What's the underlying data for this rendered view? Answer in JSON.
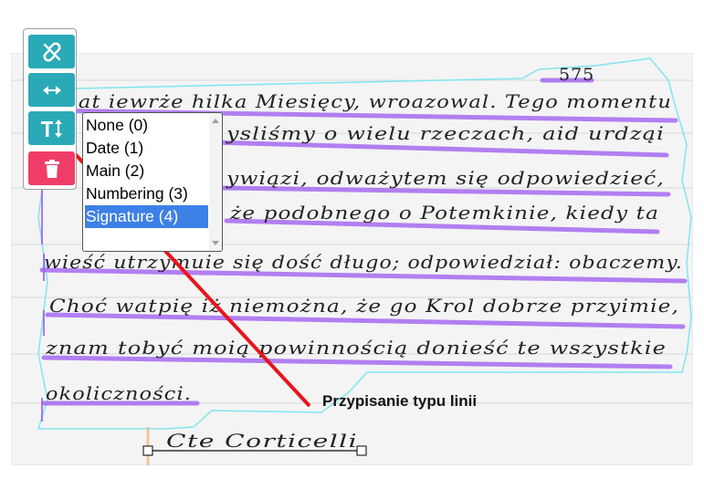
{
  "page": {
    "page_number": "575",
    "lines": [
      "Mnat iewrże hilka Miesięcy, wroazowal. Tego momentu",
      "ysliśmy  o wielu rzeczach, aid urdząi",
      "ywiązi, odważytem się odpowiedzieć,",
      "że podobnego o Potemkinie, kiedy ta",
      "wieść utrzymuie się dość długo; odpowiedział: obaczemy.",
      "Choć watpię iż niemożna, że go Krol dobrze przyimie,",
      "znam tobyć moią powinnością donieść te wszystkie",
      "okoliczności.",
      "Cte Corticelli"
    ]
  },
  "toolbar": {
    "buttons": [
      {
        "name": "unlink-button",
        "icon": "unlink-icon"
      },
      {
        "name": "resize-horizontal-button",
        "icon": "arrows-horizontal-icon"
      },
      {
        "name": "line-type-button",
        "icon": "text-height-icon"
      },
      {
        "name": "delete-button",
        "icon": "trash-icon"
      }
    ]
  },
  "line_type_select": {
    "options": [
      "None (0)",
      "Date (1)",
      "Main (2)",
      "Numbering (3)",
      "Signature (4)"
    ],
    "selected": "Signature (4)"
  },
  "annotation": {
    "label": "Przypisanie typu linii"
  },
  "colors": {
    "teal": "#2aa9b7",
    "pink": "#ef3d67",
    "baseline": "#9b59f0",
    "region": "#7fe6ee",
    "arrow": "#e8141c",
    "selected": "#3d80e6"
  }
}
